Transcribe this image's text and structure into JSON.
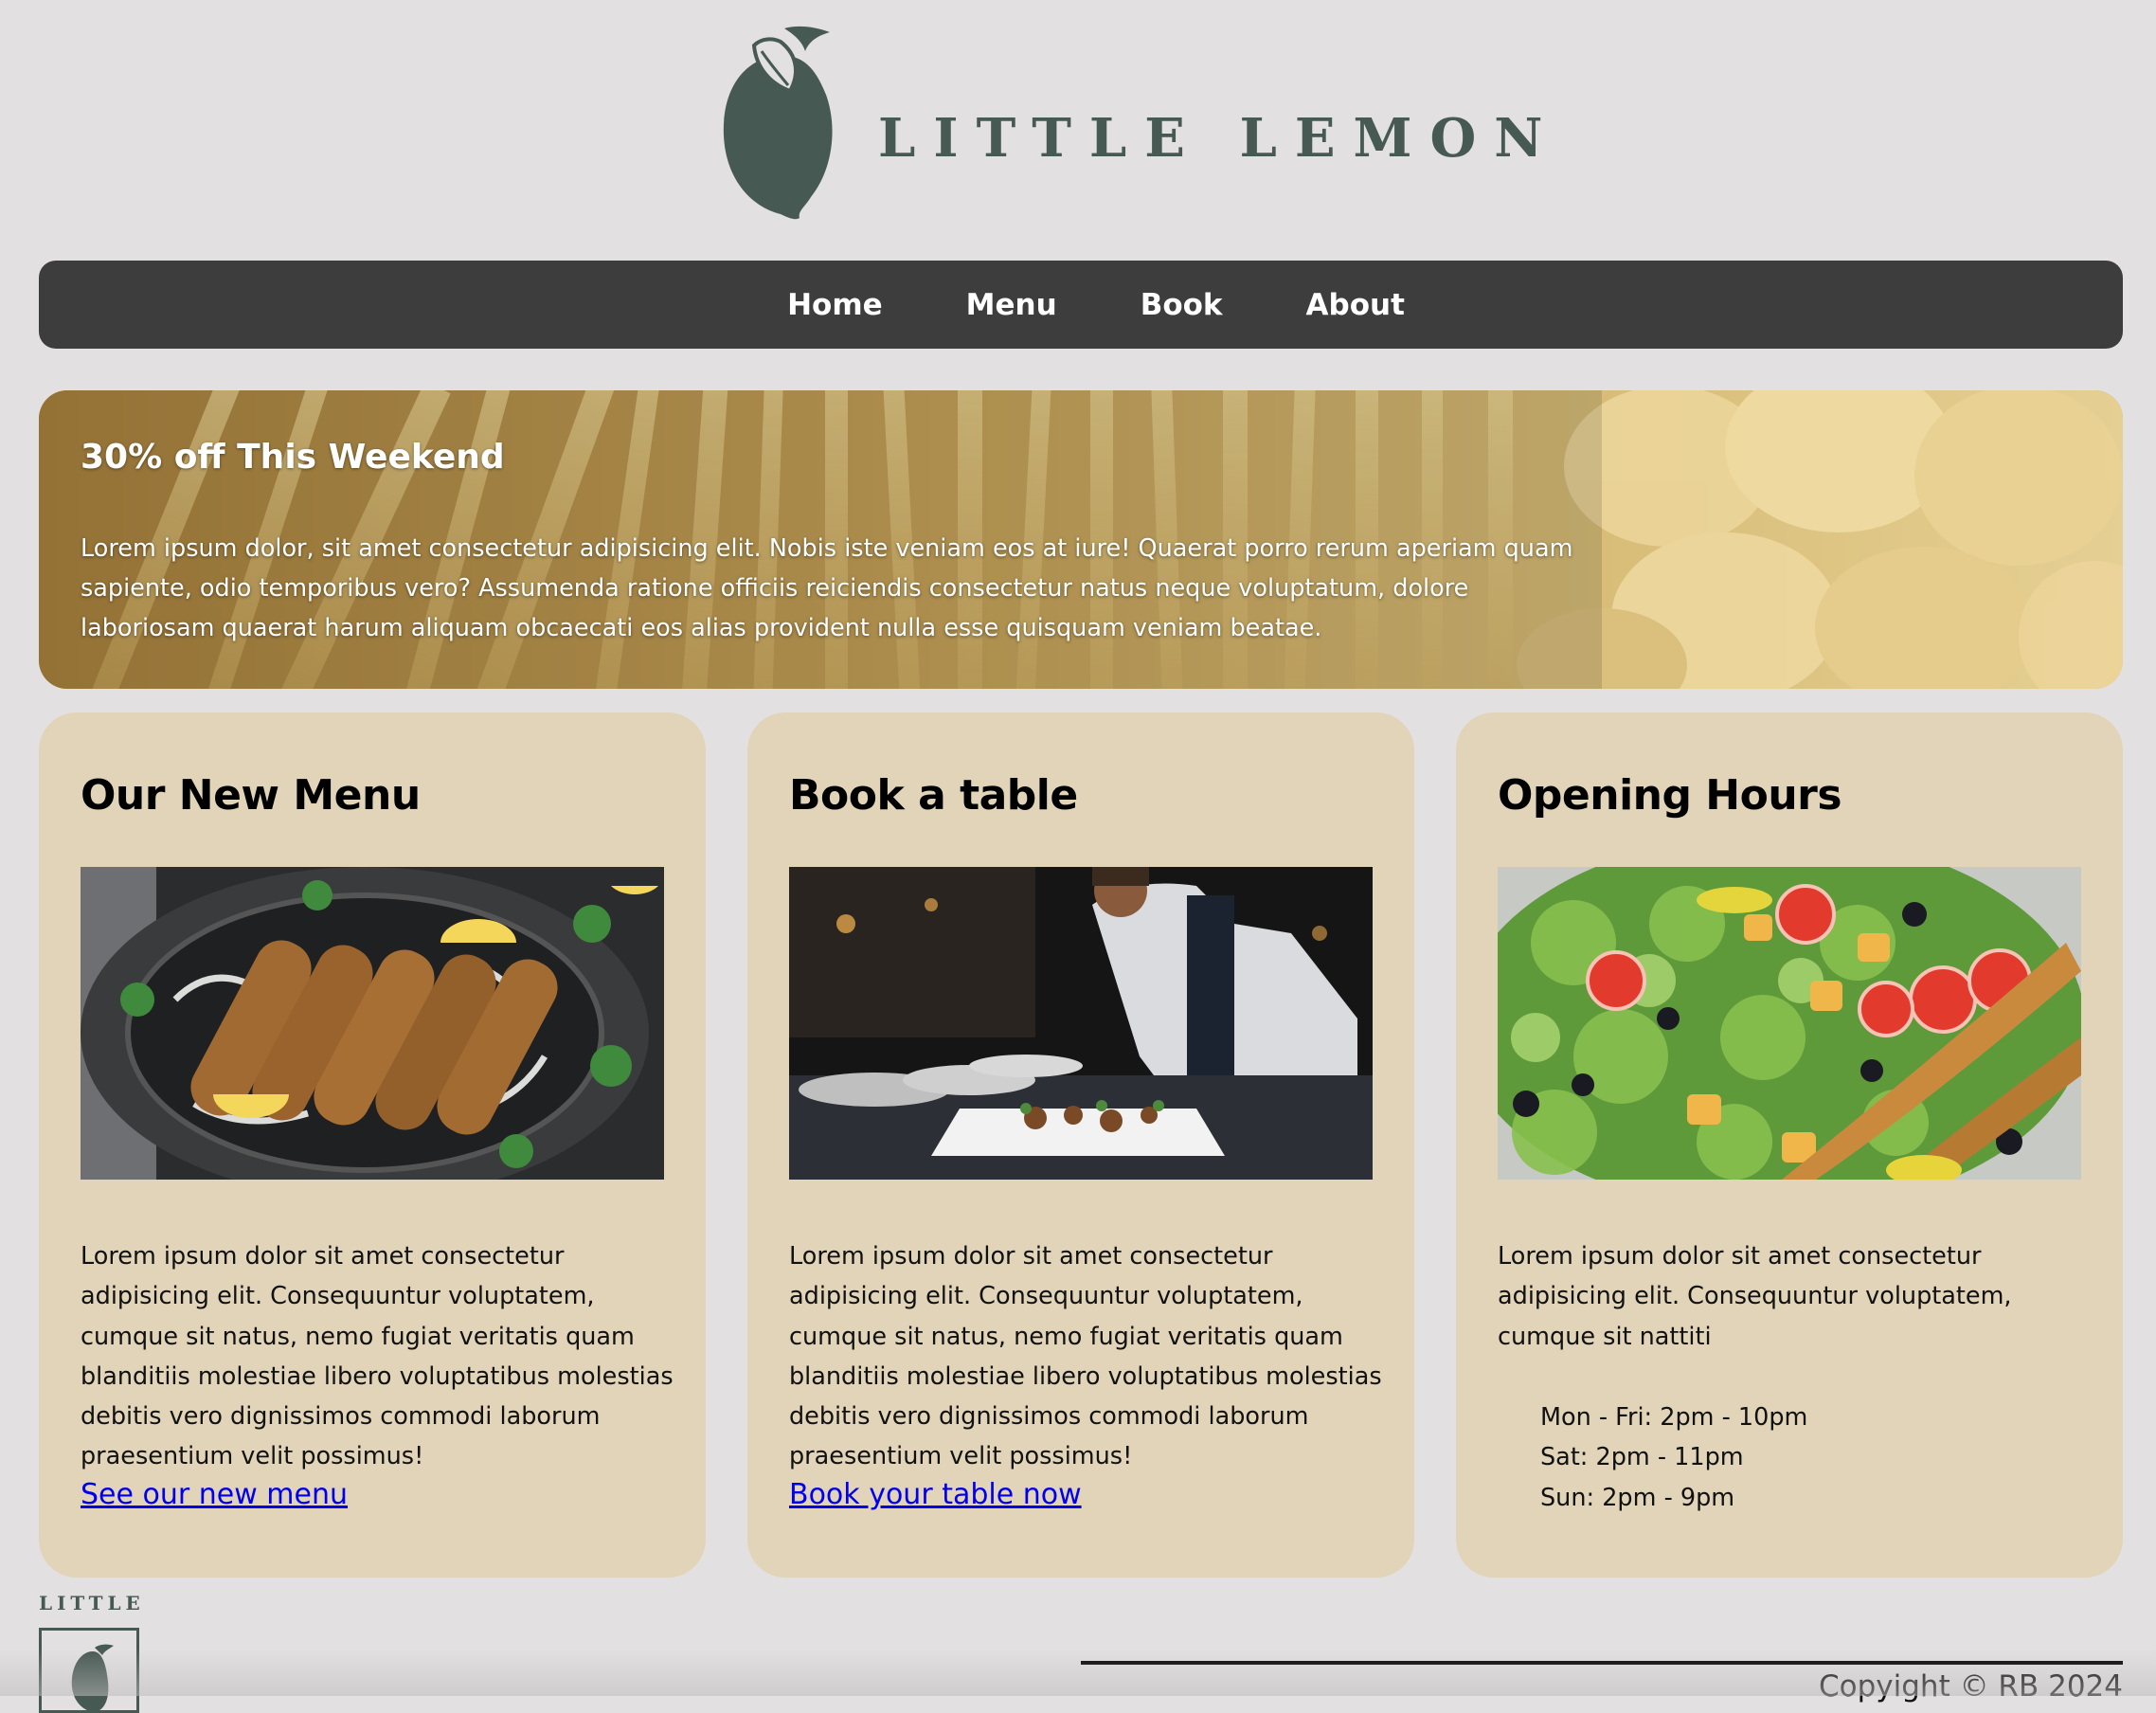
{
  "brand": {
    "name": "LITTLE LEMON",
    "footer_name": "LITTLE",
    "color": "#475953"
  },
  "nav": {
    "items": [
      {
        "label": "Home"
      },
      {
        "label": "Menu"
      },
      {
        "label": "Book"
      },
      {
        "label": "About"
      }
    ]
  },
  "hero": {
    "title": "30% off This Weekend",
    "text": "Lorem ipsum dolor, sit amet consectetur adipisicing elit. Nobis iste veniam eos at iure! Quaerat porro rerum aperiam quam sapiente, odio temporibus vero? Assumenda ratione officiis reiciendis consectetur natus neque voluptatum, dolore laboriosam quaerat harum aliquam obcaecati eos alias provident nulla esse quisquam veniam beatae."
  },
  "cards": [
    {
      "title": "Our New Menu",
      "image": "kebab-skewers-image",
      "text": "Lorem ipsum dolor sit amet consectetur adipisicing elit. Consequuntur voluptatem, cumque sit natus, nemo fugiat veritatis quam blanditiis molestiae libero voluptatibus molestias debitis vero dignissimos commodi laborum praesentium velit possimus!",
      "link": "See our new menu"
    },
    {
      "title": "Book a table",
      "image": "chef-plating-image",
      "text": "Lorem ipsum dolor sit amet consectetur adipisicing elit. Consequuntur voluptatem, cumque sit natus, nemo fugiat veritatis quam blanditiis molestiae libero voluptatibus molestias debitis vero dignissimos commodi laborum praesentium velit possimus!",
      "link": "Book your table now"
    },
    {
      "title": "Opening Hours",
      "image": "salad-image",
      "text": "Lorem ipsum dolor sit amet consectetur adipisicing elit. Consequuntur voluptatem, cumque sit nattiti",
      "hours": [
        "Mon - Fri: 2pm - 10pm",
        "Sat: 2pm - 11pm",
        "Sun: 2pm - 9pm"
      ]
    }
  ],
  "footer": {
    "copyright": "Copyight © RB 2024"
  },
  "colors": {
    "page_bg": "#e2e0e0",
    "nav_bg": "#3e3d3e",
    "card_bg": "#e1d4b8",
    "link": "#0000ee"
  }
}
